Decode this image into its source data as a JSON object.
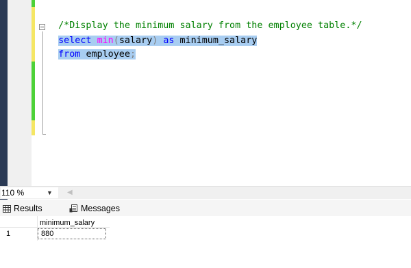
{
  "editor": {
    "lines": [
      {
        "comment": "/*Display the minimum salary from the employee table.*/"
      },
      {
        "kw1": "select",
        "fn": "min",
        "p1": "(",
        "arg": "salary",
        "p2": ")",
        "kw2": "as",
        "alias": "minimum_salary"
      },
      {
        "kw1": "from",
        "table": "employee",
        "semi": ";"
      }
    ]
  },
  "zoom": {
    "value": "110 %"
  },
  "tabs": {
    "results": "Results",
    "messages": "Messages"
  },
  "grid": {
    "columns": [
      "minimum_salary"
    ],
    "rows": [
      {
        "num": "1",
        "values": [
          "880"
        ]
      }
    ]
  },
  "colors": {
    "keyword": "#0000ff",
    "function": "#ff00ff",
    "comment": "#008000",
    "selection": "#a8cdf1",
    "change_saved": "#4cd137",
    "change_unsaved": "#f5e663"
  }
}
